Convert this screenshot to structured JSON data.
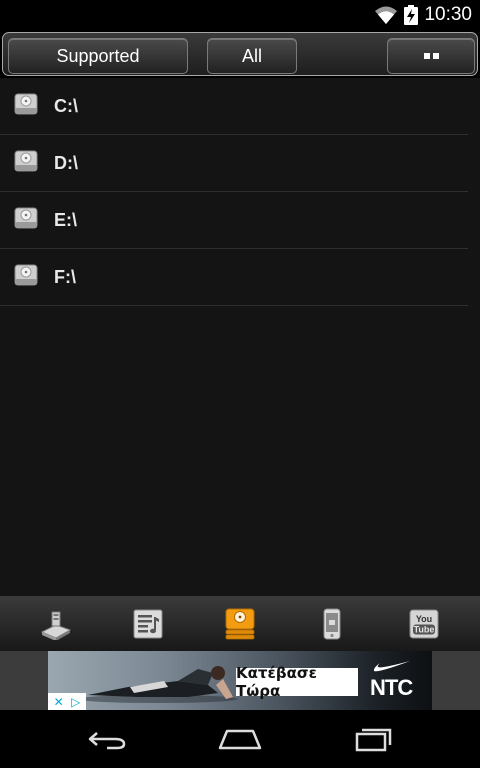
{
  "status_bar": {
    "time": "10:30",
    "icons": [
      "wifi-icon",
      "battery-charging-icon"
    ]
  },
  "filter_bar": {
    "supported_label": "Supported",
    "all_label": "All",
    "view_toggle_icon": "grid-dots-icon"
  },
  "drives": [
    {
      "label": "C:\\",
      "icon": "hard-drive-icon"
    },
    {
      "label": "D:\\",
      "icon": "hard-drive-icon"
    },
    {
      "label": "E:\\",
      "icon": "hard-drive-icon"
    },
    {
      "label": "F:\\",
      "icon": "hard-drive-icon"
    }
  ],
  "toolbar": {
    "items": [
      {
        "name": "network-icon"
      },
      {
        "name": "playlist-icon"
      },
      {
        "name": "drives-icon",
        "active": true
      },
      {
        "name": "device-icon"
      },
      {
        "name": "youtube-icon"
      }
    ]
  },
  "ad": {
    "cta_label": "Κατέβασε Τώρα",
    "brand_text": "NTC"
  },
  "nav_bar": {
    "items": [
      "back-icon",
      "home-icon",
      "recents-icon"
    ]
  },
  "colors": {
    "active_accent": "#f39c12",
    "list_bg": "#141414",
    "divider": "#2f2f2f"
  }
}
